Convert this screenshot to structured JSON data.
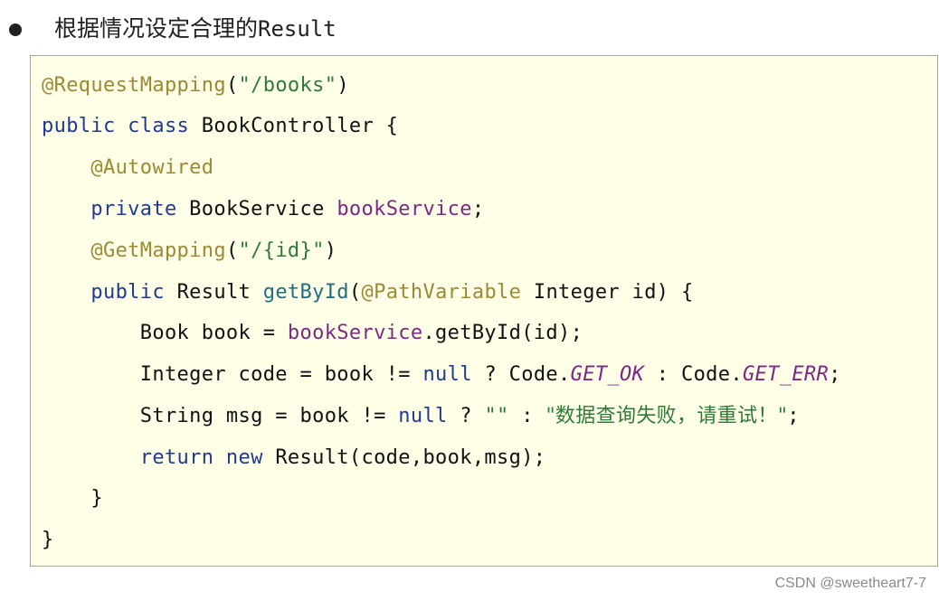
{
  "heading": {
    "bullet_icon": "bullet-dot",
    "text_cn": "根据情况设定合理的",
    "text_code": "Result"
  },
  "code": {
    "lines": [
      [
        {
          "t": "@RequestMapping",
          "c": "ann"
        },
        {
          "t": "(",
          "c": ""
        },
        {
          "t": "\"/books\"",
          "c": "str"
        },
        {
          "t": ")",
          "c": ""
        }
      ],
      [
        {
          "t": "public class",
          "c": "kw"
        },
        {
          "t": " BookController {",
          "c": ""
        }
      ],
      [
        {
          "t": "    ",
          "c": ""
        },
        {
          "t": "@Autowired",
          "c": "ann"
        }
      ],
      [
        {
          "t": "    ",
          "c": ""
        },
        {
          "t": "private",
          "c": "kw"
        },
        {
          "t": " BookService ",
          "c": ""
        },
        {
          "t": "bookService",
          "c": "fld"
        },
        {
          "t": ";",
          "c": ""
        }
      ],
      [
        {
          "t": "    ",
          "c": ""
        },
        {
          "t": "@GetMapping",
          "c": "ann"
        },
        {
          "t": "(",
          "c": ""
        },
        {
          "t": "\"/{id}\"",
          "c": "str"
        },
        {
          "t": ")",
          "c": ""
        }
      ],
      [
        {
          "t": "    ",
          "c": ""
        },
        {
          "t": "public",
          "c": "kw"
        },
        {
          "t": " Result ",
          "c": ""
        },
        {
          "t": "getById",
          "c": "mth"
        },
        {
          "t": "(",
          "c": ""
        },
        {
          "t": "@PathVariable",
          "c": "ann"
        },
        {
          "t": " Integer id) {",
          "c": ""
        }
      ],
      [
        {
          "t": "        Book book = ",
          "c": ""
        },
        {
          "t": "bookService",
          "c": "fld"
        },
        {
          "t": ".getById(id);",
          "c": ""
        }
      ],
      [
        {
          "t": "        Integer code = book != ",
          "c": ""
        },
        {
          "t": "null",
          "c": "kw"
        },
        {
          "t": " ? Code.",
          "c": ""
        },
        {
          "t": "GET_OK",
          "c": "const"
        },
        {
          "t": " : Code.",
          "c": ""
        },
        {
          "t": "GET_ERR",
          "c": "const"
        },
        {
          "t": ";",
          "c": ""
        }
      ],
      [
        {
          "t": "        String msg = book != ",
          "c": ""
        },
        {
          "t": "null",
          "c": "kw"
        },
        {
          "t": " ? ",
          "c": ""
        },
        {
          "t": "\"\"",
          "c": "str"
        },
        {
          "t": " : ",
          "c": ""
        },
        {
          "t": "\"数据查询失败，请重试！\"",
          "c": "cn-str"
        },
        {
          "t": ";",
          "c": ""
        }
      ],
      [
        {
          "t": "        ",
          "c": ""
        },
        {
          "t": "return new",
          "c": "kw"
        },
        {
          "t": " Result(code,book,msg);",
          "c": ""
        }
      ],
      [
        {
          "t": "    }",
          "c": ""
        }
      ],
      [
        {
          "t": "}",
          "c": ""
        }
      ]
    ]
  },
  "watermark": "CSDN @sweetheart7-7"
}
